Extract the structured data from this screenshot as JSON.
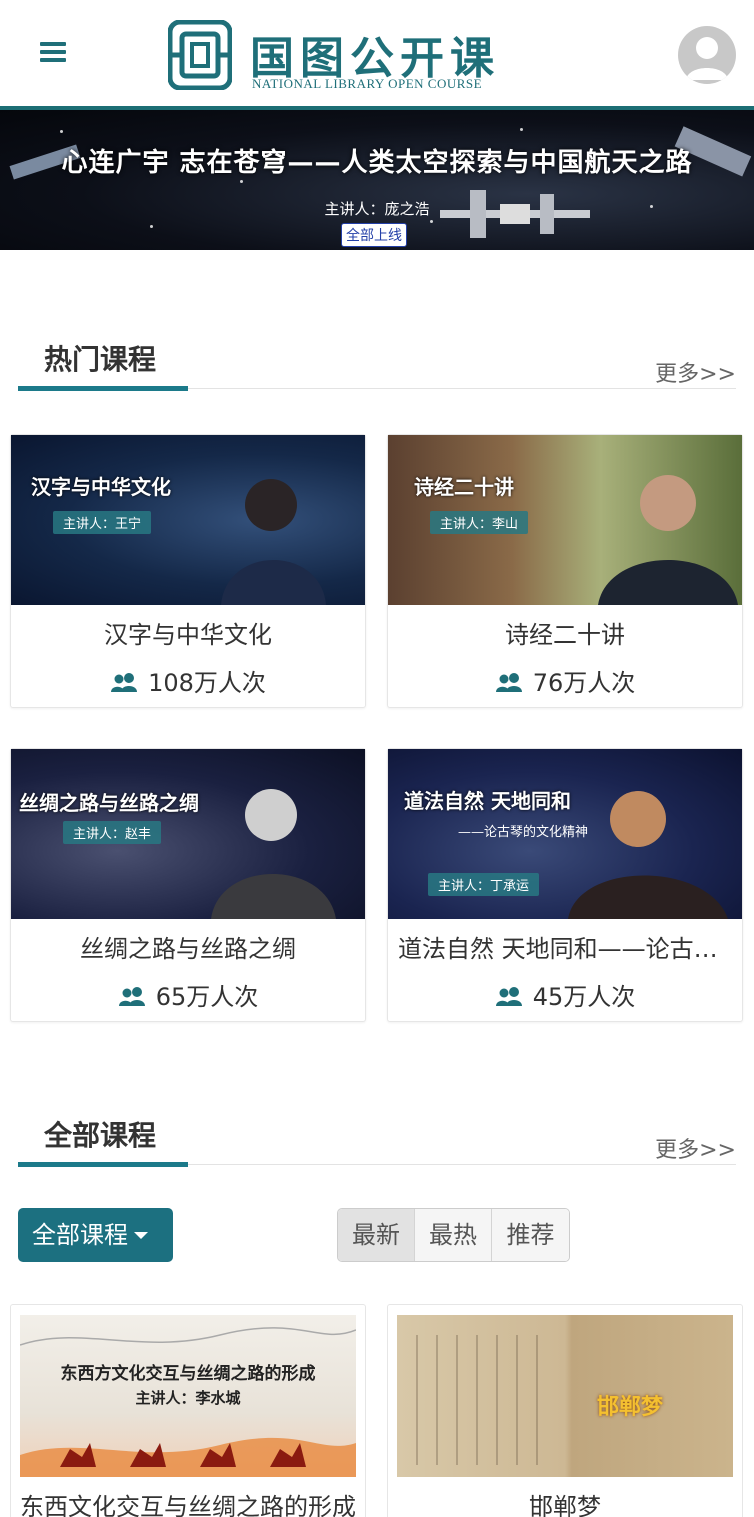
{
  "header": {
    "logo_title": "国图公开课",
    "logo_subtitle": "NATIONAL LIBRARY OPEN COURSE"
  },
  "banner": {
    "title": "心连广宇  志在苍穹——人类太空探索与中国航天之路",
    "speaker": "主讲人：庞之浩",
    "badge": "全部上线"
  },
  "hot_courses": {
    "title": "热门课程",
    "more": "更多>>",
    "items": [
      {
        "thumb_title": "汉字与中华文化",
        "thumb_speaker": "主讲人：王宁",
        "name": "汉字与中华文化",
        "views": "108万人次"
      },
      {
        "thumb_title": "诗经二十讲",
        "thumb_speaker": "主讲人：李山",
        "name": "诗经二十讲",
        "views": "76万人次"
      },
      {
        "thumb_title": "丝绸之路与丝路之绸",
        "thumb_speaker": "主讲人：赵丰",
        "name": "丝绸之路与丝路之绸",
        "views": "65万人次"
      },
      {
        "thumb_title": "道法自然  天地同和",
        "thumb_subtitle": "——论古琴的文化精神",
        "thumb_speaker": "主讲人：丁承运",
        "name": "道法自然 天地同和——论古琴的文化精神",
        "views": "45万人次"
      }
    ]
  },
  "all_courses": {
    "title": "全部课程",
    "more": "更多>>",
    "filter_label": "全部课程",
    "sort_tabs": [
      "最新",
      "最热",
      "推荐"
    ],
    "items": [
      {
        "thumb_title": "东西方文化交互与丝绸之路的形成",
        "thumb_speaker": "主讲人：李水城",
        "name": "东西文化交互与丝绸之路的形成"
      },
      {
        "thumb_title": "邯郸梦",
        "name": "邯郸梦"
      }
    ]
  },
  "colors": {
    "brand": "#1f6f79",
    "filter_bg": "#1c7080",
    "section_bar": "#1c7a8a"
  }
}
